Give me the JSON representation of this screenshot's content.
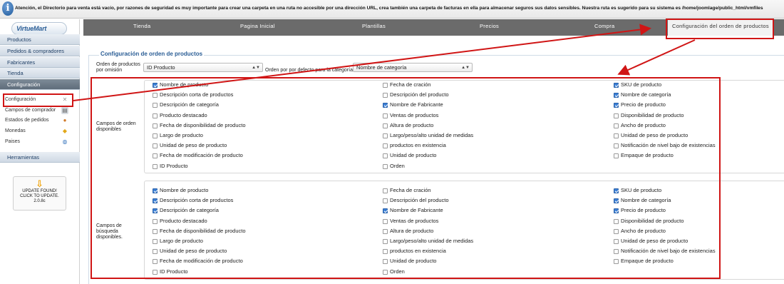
{
  "notice": {
    "icon": "info-icon",
    "text": "Atención, el Directorio para venta está vacío, por razones de seguridad es muy importante para crear una carpeta en una ruta no accesible por una dirección URL, crea también una carpeta de facturas en ella para almacenar seguros sus datos sensibles. Nuestra ruta es sugerido para su sistema es /home/joomlage/public_html/vmfiles"
  },
  "logo": {
    "text": "VirtueMart"
  },
  "sidebar": {
    "menu": [
      {
        "label": "Productos"
      },
      {
        "label": "Pedidos & compradores"
      },
      {
        "label": "Fabricantes"
      },
      {
        "label": "Tienda"
      },
      {
        "label": "Configuración"
      }
    ],
    "subitems": [
      {
        "label": "Configuración",
        "icon": "wrench-icon"
      },
      {
        "label": "Campos de comprador",
        "icon": "form-icon"
      },
      {
        "label": "Estados de pedidos",
        "icon": "status-icon"
      },
      {
        "label": "Monedas",
        "icon": "coins-icon"
      },
      {
        "label": "Paises",
        "icon": "globe-icon"
      }
    ],
    "tools": {
      "label": "Herramientas"
    },
    "update": {
      "line1": "UPDATE FOUND!",
      "line2": "CLICK TO UPDATE.",
      "line3": "2.0.8c"
    }
  },
  "tabs": [
    {
      "label": "Tienda"
    },
    {
      "label": "Pagina Inicial"
    },
    {
      "label": "Plantillas"
    },
    {
      "label": "Precios"
    },
    {
      "label": "Compra"
    },
    {
      "label": "Configuración del orden de productos"
    }
  ],
  "section": {
    "legend": "Configuración de orden de productos",
    "order_by_label": "Orden de productos por omisión",
    "order_by_value": "ID Producto",
    "category_order_label": "Orden por por defecto para la categoría",
    "category_order_value": "Nombre de categoría",
    "sort_fields_label": "Campos de orden disponibles",
    "search_fields_label": "Campos de búsqueda disponibles."
  },
  "sort_fields": {
    "col1": [
      {
        "label": "Nombre de producto",
        "checked": true
      },
      {
        "label": "Descripción corta de productos",
        "checked": false
      },
      {
        "label": "Descripción de categoría",
        "checked": false
      },
      {
        "label": "Producto destacado",
        "checked": false
      },
      {
        "label": "Fecha de disponibilidad de producto",
        "checked": false
      },
      {
        "label": "Largo de producto",
        "checked": false
      },
      {
        "label": "Unidad de peso de producto",
        "checked": false
      },
      {
        "label": "Fecha de modificación de producto",
        "checked": false
      },
      {
        "label": "ID Producto",
        "checked": false
      }
    ],
    "col2": [
      {
        "label": "Fecha de cración",
        "checked": false
      },
      {
        "label": "Descripción del producto",
        "checked": false
      },
      {
        "label": "Nombre de Fabricante",
        "checked": true
      },
      {
        "label": "Ventas de productos",
        "checked": false
      },
      {
        "label": "Altura de producto",
        "checked": false
      },
      {
        "label": "Largo/peso/alto unidad de medidas",
        "checked": false
      },
      {
        "label": "productos en existencia",
        "checked": false
      },
      {
        "label": "Unidad de producto",
        "checked": false
      },
      {
        "label": "Orden",
        "checked": false
      }
    ],
    "col3": [
      {
        "label": "SKU de producto",
        "checked": true
      },
      {
        "label": "Nombre de categoría",
        "checked": true
      },
      {
        "label": "Precio de producto",
        "checked": true
      },
      {
        "label": "Disponibilidad de producto",
        "checked": false
      },
      {
        "label": "Ancho de producto",
        "checked": false
      },
      {
        "label": "Unidad de peso de producto",
        "checked": false
      },
      {
        "label": "Notificación de nivel bajo de existencias",
        "checked": false
      },
      {
        "label": "Empaque de producto",
        "checked": false
      }
    ]
  },
  "search_fields": {
    "col1": [
      {
        "label": "Nombre de producto",
        "checked": true
      },
      {
        "label": "Descripción corta de productos",
        "checked": true
      },
      {
        "label": "Descripción de categoría",
        "checked": true
      },
      {
        "label": "Producto destacado",
        "checked": false
      },
      {
        "label": "Fecha de disponibilidad de producto",
        "checked": false
      },
      {
        "label": "Largo de producto",
        "checked": false
      },
      {
        "label": "Unidad de peso de producto",
        "checked": false
      },
      {
        "label": "Fecha de modificación de producto",
        "checked": false
      },
      {
        "label": "ID Producto",
        "checked": false
      }
    ],
    "col2": [
      {
        "label": "Fecha de cración",
        "checked": false
      },
      {
        "label": "Descripción del producto",
        "checked": false
      },
      {
        "label": "Nombre de Fabricante",
        "checked": true
      },
      {
        "label": "Ventas de productos",
        "checked": false
      },
      {
        "label": "Altura de producto",
        "checked": false
      },
      {
        "label": "Largo/peso/alto unidad de medidas",
        "checked": false
      },
      {
        "label": "productos en existencia",
        "checked": false
      },
      {
        "label": "Unidad de producto",
        "checked": false
      },
      {
        "label": "Orden",
        "checked": false
      }
    ],
    "col3": [
      {
        "label": "SKU de producto",
        "checked": true
      },
      {
        "label": "Nombre de categoría",
        "checked": true
      },
      {
        "label": "Precio de producto",
        "checked": true
      },
      {
        "label": "Disponibilidad de producto",
        "checked": false
      },
      {
        "label": "Ancho de producto",
        "checked": false
      },
      {
        "label": "Unidad de peso de producto",
        "checked": false
      },
      {
        "label": "Notificación de nivel bajo de existencias",
        "checked": false
      },
      {
        "label": "Empaque de producto",
        "checked": false
      }
    ]
  },
  "colors": {
    "annotation": "#d01515",
    "tabbar": "#6b6b6b",
    "legend": "#2a5d95",
    "checkbox_checked": "#3b7fd6"
  }
}
